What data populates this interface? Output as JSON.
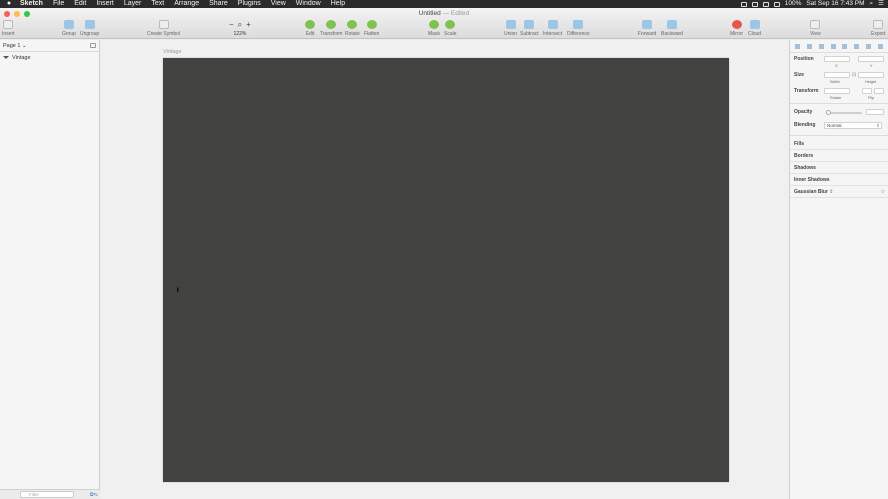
{
  "menubar": {
    "app": "Sketch",
    "items": [
      "File",
      "Edit",
      "Insert",
      "Layer",
      "Text",
      "Arrange",
      "Share",
      "Plugins",
      "View",
      "Window",
      "Help"
    ],
    "battery": "100%",
    "datetime": "Sat Sep 16  7:43 PM"
  },
  "window": {
    "title": "Untitled",
    "edited": "— Edited"
  },
  "toolbar": {
    "insert": "Insert",
    "group": "Group",
    "ungroup": "Ungroup",
    "create_symbol": "Create Symbol",
    "zoom_minus": "−",
    "zoom_plus": "+",
    "zoom_level": "122%",
    "edit": "Edit",
    "transform": "Transform",
    "rotate": "Rotate",
    "flatten": "Flatten",
    "mask": "Mask",
    "scale": "Scale",
    "union": "Union",
    "subtract": "Subtract",
    "intersect": "Intersect",
    "difference": "Difference",
    "forward": "Forward",
    "backward": "Backward",
    "mirror": "Mirror",
    "cloud": "Cloud",
    "view": "View",
    "export": "Export"
  },
  "sidebar": {
    "page": "Page 1",
    "layers": [
      {
        "name": "Vintage"
      }
    ],
    "filter_placeholder": "Filter"
  },
  "canvas": {
    "artboard_name": "Vintage",
    "artboard_color": "#424341"
  },
  "inspector": {
    "position": "Position",
    "x": "X",
    "y": "Y",
    "size": "Size",
    "width": "Width",
    "height": "Height",
    "transform": "Transform",
    "rotate": "Rotate",
    "flip": "Flip",
    "opacity": "Opacity",
    "blending": "Blending",
    "blending_value": "Normal",
    "fills": "Fills",
    "borders": "Borders",
    "shadows": "Shadows",
    "inner_shadows": "Inner Shadows",
    "gaussian_blur": "Gaussian Blur"
  }
}
